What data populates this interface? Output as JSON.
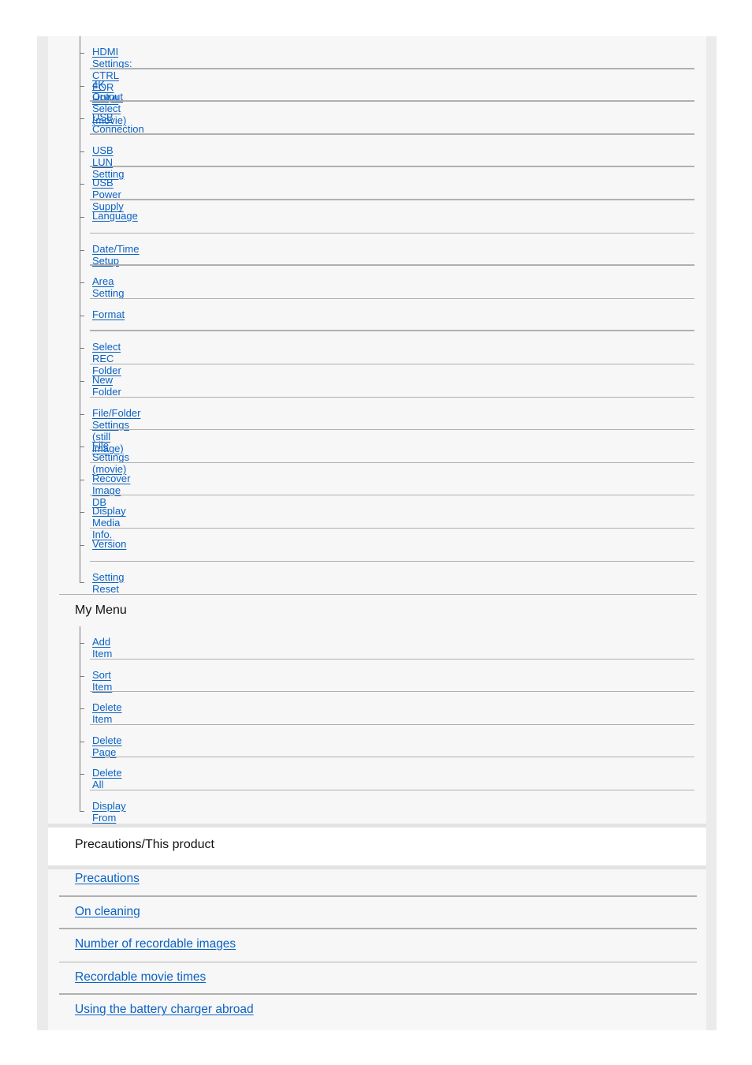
{
  "setup_menu": {
    "items": [
      {
        "label": "HDMI Settings: CTRL FOR HDMI"
      },
      {
        "label": "4K Output Select (movie)"
      },
      {
        "label": "USB Connection"
      },
      {
        "label": "USB LUN Setting"
      },
      {
        "label": "USB Power Supply"
      },
      {
        "label": "Language "
      },
      {
        "label": "Date/Time Setup"
      },
      {
        "label": "Area Setting"
      },
      {
        "label": "Format"
      },
      {
        "label": "Select REC Folder"
      },
      {
        "label": "New Folder"
      },
      {
        "label": "File/Folder Settings (still image)"
      },
      {
        "label": "File Settings (movie)"
      },
      {
        "label": "Recover Image DB"
      },
      {
        "label": "Display Media Info."
      },
      {
        "label": "Version"
      },
      {
        "label": "Setting Reset"
      }
    ]
  },
  "my_menu": {
    "heading": "My Menu",
    "items": [
      {
        "label": "Add Item"
      },
      {
        "label": "Sort Item"
      },
      {
        "label": "Delete Item"
      },
      {
        "label": "Delete Page"
      },
      {
        "label": "Delete All"
      },
      {
        "label": "Display From My Menu"
      }
    ]
  },
  "precautions": {
    "heading": "Precautions/This product",
    "items": [
      {
        "label": "Precautions"
      },
      {
        "label": "On cleaning"
      },
      {
        "label": "Number of recordable images"
      },
      {
        "label": "Recordable movie times"
      },
      {
        "label": "Using the battery charger abroad"
      }
    ]
  },
  "colors": {
    "link": "#0b62c4",
    "panel": "#f7f7f7",
    "frame": "#ebebeb"
  }
}
